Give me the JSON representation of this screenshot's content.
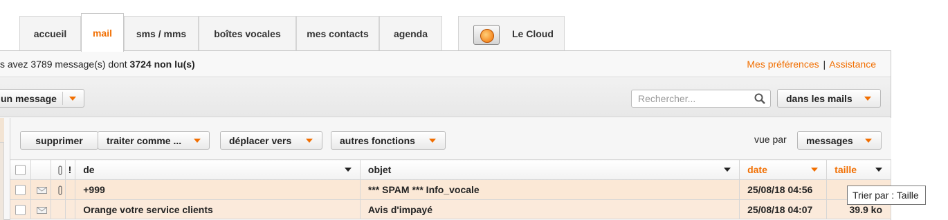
{
  "tabs": [
    {
      "label": "accueil",
      "active": false
    },
    {
      "label": "mail",
      "active": true
    },
    {
      "label": "sms / mms",
      "active": false
    },
    {
      "label": "boîtes vocales",
      "active": false
    },
    {
      "label": "mes contacts",
      "active": false
    },
    {
      "label": "agenda",
      "active": false
    }
  ],
  "cloud_tab": {
    "label": "Le Cloud",
    "icon": "cloud-folder-icon"
  },
  "info": {
    "prefix": "s avez  3789 message(s) dont  ",
    "unread": "3724 non lu(s)"
  },
  "links": {
    "preferences": "Mes préférences",
    "separator": "|",
    "assistance": "Assistance"
  },
  "toolbar": {
    "new_message": "un message",
    "search_placeholder": "Rechercher...",
    "search_scope": "dans les mails"
  },
  "actions": {
    "delete": "supprimer",
    "treat_as": "traiter comme ...",
    "move_to": "déplacer vers",
    "other": "autres fonctions",
    "view_label": "vue par",
    "view_value": "messages"
  },
  "columns": {
    "from": "de",
    "subject": "objet",
    "date": "date",
    "size": "taille"
  },
  "messages": [
    {
      "from": "+999",
      "subject": "*** SPAM *** Info_vocale",
      "date": "25/08/18 04:56",
      "size": "",
      "attachment": true
    },
    {
      "from": "Orange votre service clients",
      "subject": "Avis d'impayé",
      "date": "25/08/18 04:07",
      "size": "39.9 ko",
      "attachment": false
    }
  ],
  "tooltip": "Trier par : Taille",
  "colors": {
    "accent": "#f16e00",
    "row_highlight": "#fbe8d6"
  }
}
